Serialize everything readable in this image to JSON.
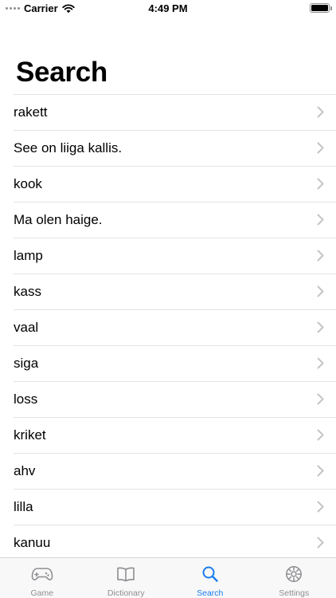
{
  "status_bar": {
    "carrier": "Carrier",
    "time": "4:49 PM"
  },
  "page": {
    "title": "Search"
  },
  "list": {
    "items": [
      {
        "label": "rakett"
      },
      {
        "label": "See on liiga kallis."
      },
      {
        "label": "kook"
      },
      {
        "label": "Ma olen haige."
      },
      {
        "label": "lamp"
      },
      {
        "label": "kass"
      },
      {
        "label": "vaal"
      },
      {
        "label": "siga"
      },
      {
        "label": "loss"
      },
      {
        "label": "kriket"
      },
      {
        "label": "ahv"
      },
      {
        "label": "lilla"
      },
      {
        "label": "kanuu"
      }
    ]
  },
  "tab_bar": {
    "tabs": [
      {
        "label": "Game",
        "icon": "gamecontroller-icon",
        "active": false
      },
      {
        "label": "Dictionary",
        "icon": "book-icon",
        "active": false
      },
      {
        "label": "Search",
        "icon": "magnifier-icon",
        "active": true
      },
      {
        "label": "Settings",
        "icon": "gear-icon",
        "active": false
      }
    ]
  },
  "colors": {
    "accent": "#1a7cf0",
    "inactive_tab": "#8e8e93",
    "separator": "#e3e3e6",
    "chevron": "#c4c4c7"
  }
}
